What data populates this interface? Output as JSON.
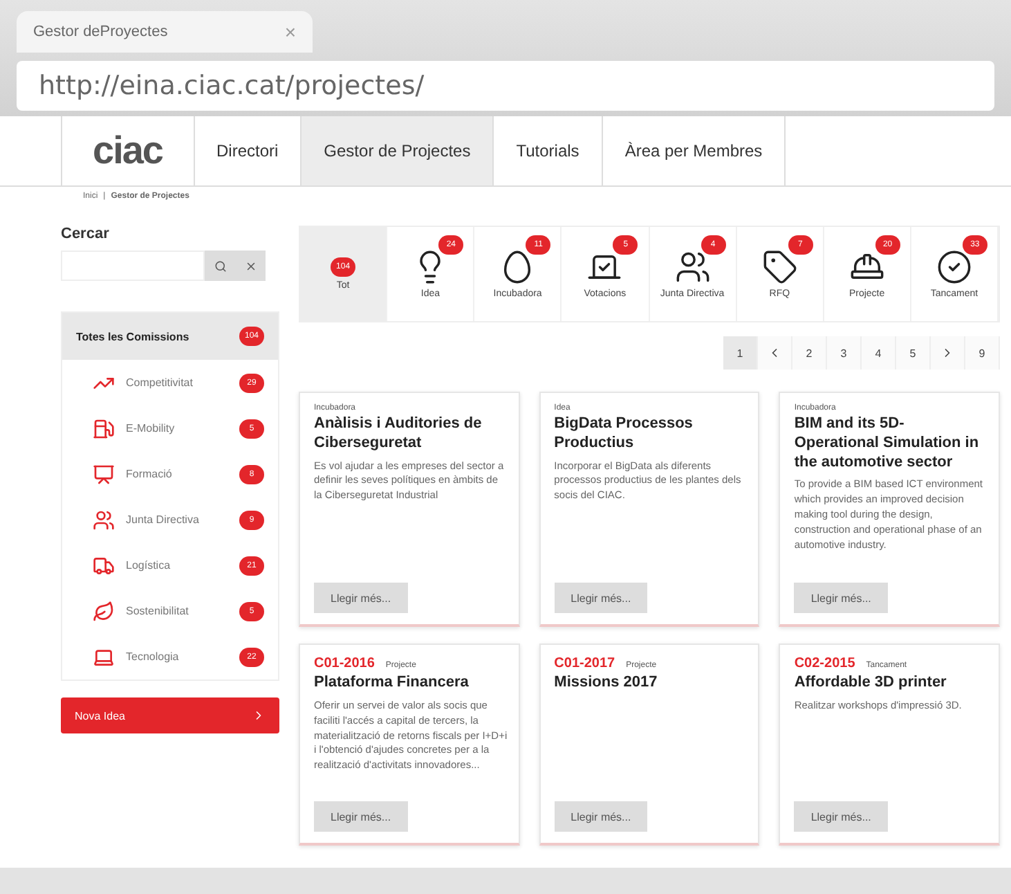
{
  "browser": {
    "tab_title": "Gestor deProyectes",
    "tab_close": "×",
    "url": "http://eina.ciac.cat/projectes/"
  },
  "nav": {
    "logo": "ciac",
    "items": [
      {
        "label": "Directori",
        "selected": false
      },
      {
        "label": "Gestor de Projectes",
        "selected": true
      },
      {
        "label": "Tutorials",
        "selected": false
      },
      {
        "label": "Àrea per Membres",
        "selected": false
      }
    ]
  },
  "breadcrumb": {
    "items": [
      "Inici",
      "Gestor de Projectes"
    ],
    "separator": "|"
  },
  "search": {
    "label": "Cercar"
  },
  "commissions": [
    {
      "kind": "all",
      "label": "Totes les Comissions",
      "count": "104",
      "selected": true
    },
    {
      "kind": "chart",
      "label": "Competitivitat",
      "count": "29",
      "selected": false
    },
    {
      "kind": "fuel",
      "label": "E-Mobility",
      "count": "5",
      "selected": false
    },
    {
      "kind": "board",
      "label": "Formació",
      "count": "8",
      "selected": false
    },
    {
      "kind": "people",
      "label": "Junta Directiva",
      "count": "9",
      "selected": false
    },
    {
      "kind": "truck",
      "label": "Logística",
      "count": "21",
      "selected": false
    },
    {
      "kind": "leaf",
      "label": "Sostenibilitat",
      "count": "5",
      "selected": false
    },
    {
      "kind": "laptop",
      "label": "Tecnologia",
      "count": "22",
      "selected": false
    }
  ],
  "new_idea_button": {
    "label": "Nova Idea"
  },
  "stages": [
    {
      "kind": "all",
      "label": "Tot",
      "count": "104",
      "selected": true
    },
    {
      "kind": "idea",
      "label": "Idea",
      "count": "24",
      "selected": false
    },
    {
      "kind": "egg",
      "label": "Incubadora",
      "count": "11",
      "selected": false
    },
    {
      "kind": "vote",
      "label": "Votacions",
      "count": "5",
      "selected": false
    },
    {
      "kind": "people",
      "label": "Junta Directiva",
      "count": "4",
      "selected": false
    },
    {
      "kind": "tag",
      "label": "RFQ",
      "count": "7",
      "selected": false
    },
    {
      "kind": "worker",
      "label": "Projecte",
      "count": "20",
      "selected": false
    },
    {
      "kind": "check",
      "label": "Tancament",
      "count": "33",
      "selected": false
    }
  ],
  "pagination": [
    {
      "kind": "page",
      "label": "1",
      "selected": true
    },
    {
      "kind": "prev",
      "selected": false
    },
    {
      "kind": "page",
      "label": "2",
      "selected": false
    },
    {
      "kind": "page",
      "label": "3",
      "selected": false
    },
    {
      "kind": "page",
      "label": "4",
      "selected": false
    },
    {
      "kind": "page",
      "label": "5",
      "selected": false
    },
    {
      "kind": "next",
      "selected": false
    },
    {
      "kind": "page",
      "label": "9",
      "selected": false
    }
  ],
  "cards": [
    {
      "type": "Incubadora",
      "title": "Anàlisis i Auditories de Ciberseguretat",
      "description": "Es vol ajudar a les empreses del sector a definir les seves polítiques en àmbits de la Ciberseguretat Industrial",
      "button": "Llegir més..."
    },
    {
      "type": "Idea",
      "title": "BigData Processos Productius",
      "description": "Incorporar el BigData als diferents processos productius de les plantes dels socis del CIAC.",
      "button": "Llegir més..."
    },
    {
      "type": "Incubadora",
      "title": "BIM and its 5D-Operational Simulation in the automotive sector",
      "description": "To provide a BIM based ICT environment which provides an improved decision making tool during the design, construction and operational phase of an automotive industry.",
      "button": "Llegir més..."
    },
    {
      "code": "C01-2016",
      "type": "Projecte",
      "title": "Plataforma Financera",
      "description": "Oferir un servei de valor als socis que faciliti l'accés a capital de tercers, la materialització de retorns fiscals per I+D+i i l'obtenció d'ajudes concretes per a la realització d'activitats innovadores...",
      "button": "Llegir més..."
    },
    {
      "code": "C01-2017",
      "type": "Projecte",
      "title": "Missions 2017",
      "button": "Llegir més..."
    },
    {
      "code": "C02-2015",
      "type": "Tancament",
      "title": "Affordable 3D printer",
      "description": "Realitzar workshops d'impressió 3D.",
      "button": "Llegir més..."
    }
  ]
}
